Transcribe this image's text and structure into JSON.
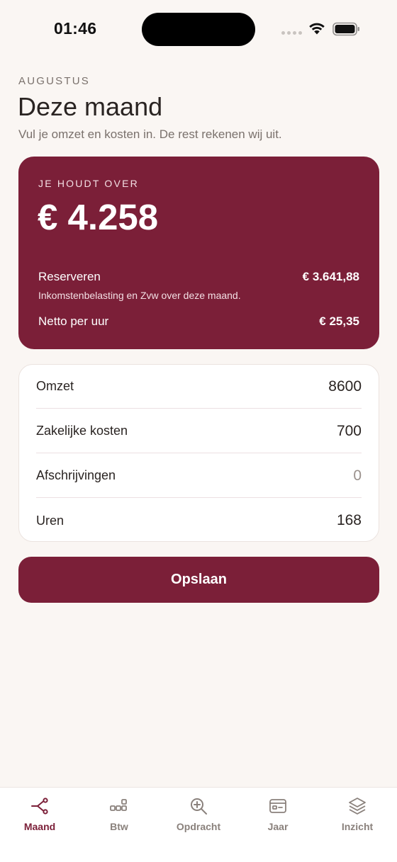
{
  "status_bar": {
    "time": "01:46"
  },
  "header": {
    "month": "AUGUSTUS",
    "title": "Deze maand",
    "subtitle": "Vul je omzet en kosten in. De rest rekenen wij uit."
  },
  "result": {
    "label": "JE HOUDT OVER",
    "amount": "€ 4.258",
    "reserve_label": "Reserveren",
    "reserve_value": "€ 3.641,88",
    "reserve_note": "Inkomstenbelasting en Zvw over deze maand.",
    "hourly_label": "Netto per uur",
    "hourly_value": "€ 25,35"
  },
  "inputs": [
    {
      "label": "Omzet",
      "value": "8600"
    },
    {
      "label": "Zakelijke kosten",
      "value": "700"
    },
    {
      "label": "Afschrijvingen",
      "value": "0"
    },
    {
      "label": "Uren",
      "value": "168"
    }
  ],
  "save_label": "Opslaan",
  "tabs": [
    {
      "label": "Maand",
      "icon": "share-nodes-icon",
      "active": true
    },
    {
      "label": "Btw",
      "icon": "blocks-icon",
      "active": false
    },
    {
      "label": "Opdracht",
      "icon": "zoom-in-icon",
      "active": false
    },
    {
      "label": "Jaar",
      "icon": "card-icon",
      "active": false
    },
    {
      "label": "Inzicht",
      "icon": "layers-icon",
      "active": false
    }
  ],
  "colors": {
    "accent": "#7b1f38",
    "background": "#faf6f3",
    "muted_text": "#7a716c",
    "inactive_tab": "#8a817c"
  }
}
